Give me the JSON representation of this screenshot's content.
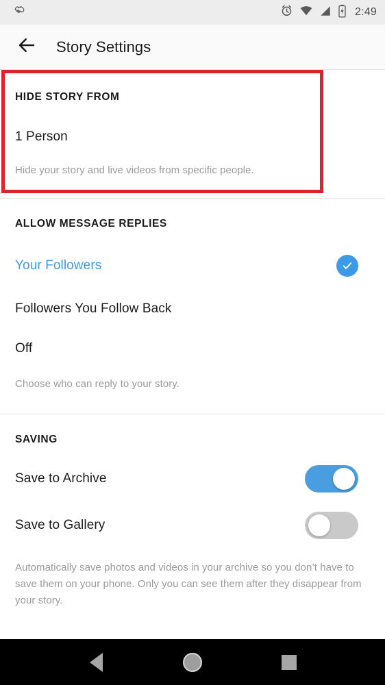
{
  "status_bar": {
    "time": "2:49",
    "left_icons": [
      "shoe-icon"
    ],
    "right_icons": [
      "alarm-icon",
      "wifi-icon",
      "cell-signal-icon",
      "battery-charging-icon"
    ],
    "background_color": "#ededed"
  },
  "app_bar": {
    "back_icon": "back-arrow-icon",
    "title": "Story Settings"
  },
  "hide_story": {
    "header": "HIDE STORY FROM",
    "count_label": "1 Person",
    "description": "Hide your story and live videos from specific people.",
    "highlight_color": "#e0222a"
  },
  "allow_message_replies": {
    "header": "ALLOW MESSAGE REPLIES",
    "options": [
      {
        "label": "Your Followers",
        "selected": true
      },
      {
        "label": "Followers You Follow Back",
        "selected": false
      },
      {
        "label": "Off",
        "selected": false
      }
    ],
    "description": "Choose who can reply to your story.",
    "selected_color": "#3d9ae8",
    "check_icon": "check-circle-icon"
  },
  "saving": {
    "header": "SAVING",
    "toggles": [
      {
        "label": "Save to Archive",
        "state": "on"
      },
      {
        "label": "Save to Gallery",
        "state": "off"
      }
    ],
    "description": "Automatically save photos and videos in your archive so you don’t have to save them on your phone. Only you can see them after they disappear from your story.",
    "on_color": "#4a9ee0",
    "off_color": "#c9c9c9"
  },
  "nav_bar": {
    "buttons": [
      {
        "name": "back",
        "icon": "triangle-back-icon"
      },
      {
        "name": "home",
        "icon": "circle-home-icon"
      },
      {
        "name": "recents",
        "icon": "square-recents-icon"
      }
    ],
    "background_color": "#000000"
  }
}
